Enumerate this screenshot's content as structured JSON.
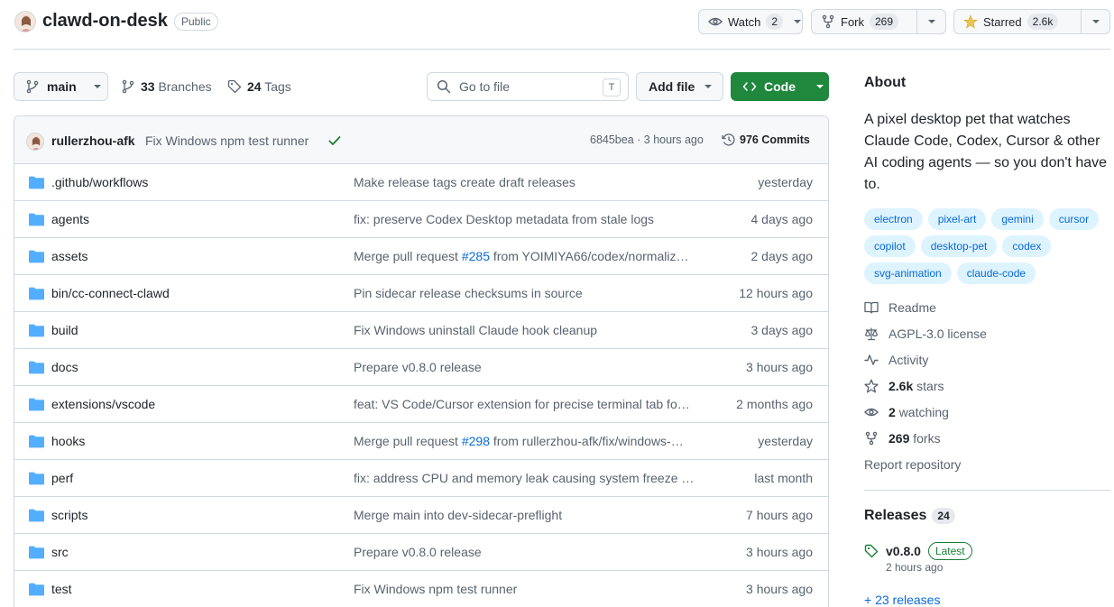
{
  "repo": {
    "name": "clawd-on-desk",
    "visibility": "Public",
    "watch_label": "Watch",
    "watch_count": "2",
    "fork_label": "Fork",
    "fork_count": "269",
    "star_label": "Starred",
    "star_count": "2.6k"
  },
  "toolbar": {
    "branch": "main",
    "branches_count": "33",
    "branches_label": "Branches",
    "tags_count": "24",
    "tags_label": "Tags",
    "search_placeholder": "Go to file",
    "search_shortcut": "T",
    "add_file_label": "Add file",
    "code_label": "Code"
  },
  "latest_commit": {
    "author": "rullerzhou-afk",
    "message": "Fix Windows npm test runner",
    "sha_time": "6845bea · 3 hours ago",
    "commits_label": "976 Commits"
  },
  "files": [
    {
      "name": ".github/workflows",
      "msg_pre": "Make release tags create draft releases",
      "pr": "",
      "msg_post": "",
      "time": "yesterday"
    },
    {
      "name": "agents",
      "msg_pre": "fix: preserve Codex Desktop metadata from stale logs",
      "pr": "",
      "msg_post": "",
      "time": "4 days ago"
    },
    {
      "name": "assets",
      "msg_pre": "Merge pull request ",
      "pr": "#285",
      "msg_post": " from YOIMIYA66/codex/normaliz…",
      "time": "2 days ago"
    },
    {
      "name": "bin/cc-connect-clawd",
      "msg_pre": "Pin sidecar release checksums in source",
      "pr": "",
      "msg_post": "",
      "time": "12 hours ago"
    },
    {
      "name": "build",
      "msg_pre": "Fix Windows uninstall Claude hook cleanup",
      "pr": "",
      "msg_post": "",
      "time": "3 days ago"
    },
    {
      "name": "docs",
      "msg_pre": "Prepare v0.8.0 release",
      "pr": "",
      "msg_post": "",
      "time": "3 hours ago"
    },
    {
      "name": "extensions/vscode",
      "msg_pre": "feat: VS Code/Cursor extension for precise terminal tab fo…",
      "pr": "",
      "msg_post": "",
      "time": "2 months ago"
    },
    {
      "name": "hooks",
      "msg_pre": "Merge pull request ",
      "pr": "#298",
      "msg_post": " from rullerzhou-afk/fix/windows-…",
      "time": "yesterday"
    },
    {
      "name": "perf",
      "msg_pre": "fix: address CPU and memory leak causing system freeze …",
      "pr": "",
      "msg_post": "",
      "time": "last month"
    },
    {
      "name": "scripts",
      "msg_pre": "Merge main into dev-sidecar-preflight",
      "pr": "",
      "msg_post": "",
      "time": "7 hours ago"
    },
    {
      "name": "src",
      "msg_pre": "Prepare v0.8.0 release",
      "pr": "",
      "msg_post": "",
      "time": "3 hours ago"
    },
    {
      "name": "test",
      "msg_pre": "Fix Windows npm test runner",
      "pr": "",
      "msg_post": "",
      "time": "3 hours ago"
    }
  ],
  "about": {
    "heading": "About",
    "description": "A pixel desktop pet that watches Claude Code, Codex, Cursor & other AI coding agents — so you don't have to.",
    "topics": [
      "electron",
      "pixel-art",
      "gemini",
      "cursor",
      "copilot",
      "desktop-pet",
      "codex",
      "svg-animation",
      "claude-code"
    ],
    "readme": "Readme",
    "license": "AGPL-3.0 license",
    "activity": "Activity",
    "stars_count": "2.6k",
    "stars_label": "stars",
    "watching_count": "2",
    "watching_label": "watching",
    "forks_count": "269",
    "forks_label": "forks",
    "report": "Report repository"
  },
  "releases": {
    "heading": "Releases",
    "count": "24",
    "latest_version": "v0.8.0",
    "latest_badge": "Latest",
    "latest_date": "2 hours ago",
    "more": "+ 23 releases"
  },
  "colors": {
    "accent": "#0969da",
    "code_button": "#1f883d",
    "folder": "#54aeff",
    "latest_badge": "#1a7f37"
  }
}
